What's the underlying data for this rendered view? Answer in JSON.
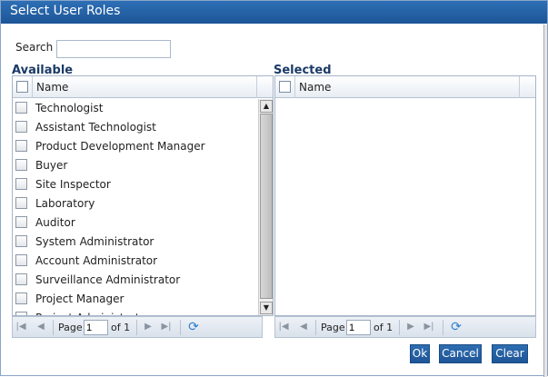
{
  "dialog": {
    "title": "Select User Roles"
  },
  "search": {
    "label": "Search",
    "value": "",
    "placeholder": ""
  },
  "available": {
    "title": "Available",
    "column_header": "Name",
    "items": [
      "Technologist",
      "Assistant Technologist",
      "Product Development Manager",
      "Buyer",
      "Site Inspector",
      "Laboratory",
      "Auditor",
      "System Administrator",
      "Account Administrator",
      "Surveillance Administrator",
      "Project Manager",
      "Project Administrator"
    ],
    "pager": {
      "page_label": "Page",
      "page_value": "1",
      "of_label": "of 1"
    }
  },
  "selected": {
    "title": "Selected",
    "column_header": "Name",
    "items": [],
    "pager": {
      "page_label": "Page",
      "page_value": "1",
      "of_label": "of 1"
    }
  },
  "buttons": {
    "ok": "Ok",
    "cancel": "Cancel",
    "clear": "Clear"
  },
  "colors": {
    "titlebar": "#1d5597",
    "button": "#1e5597",
    "section_title": "#1b3a66"
  }
}
